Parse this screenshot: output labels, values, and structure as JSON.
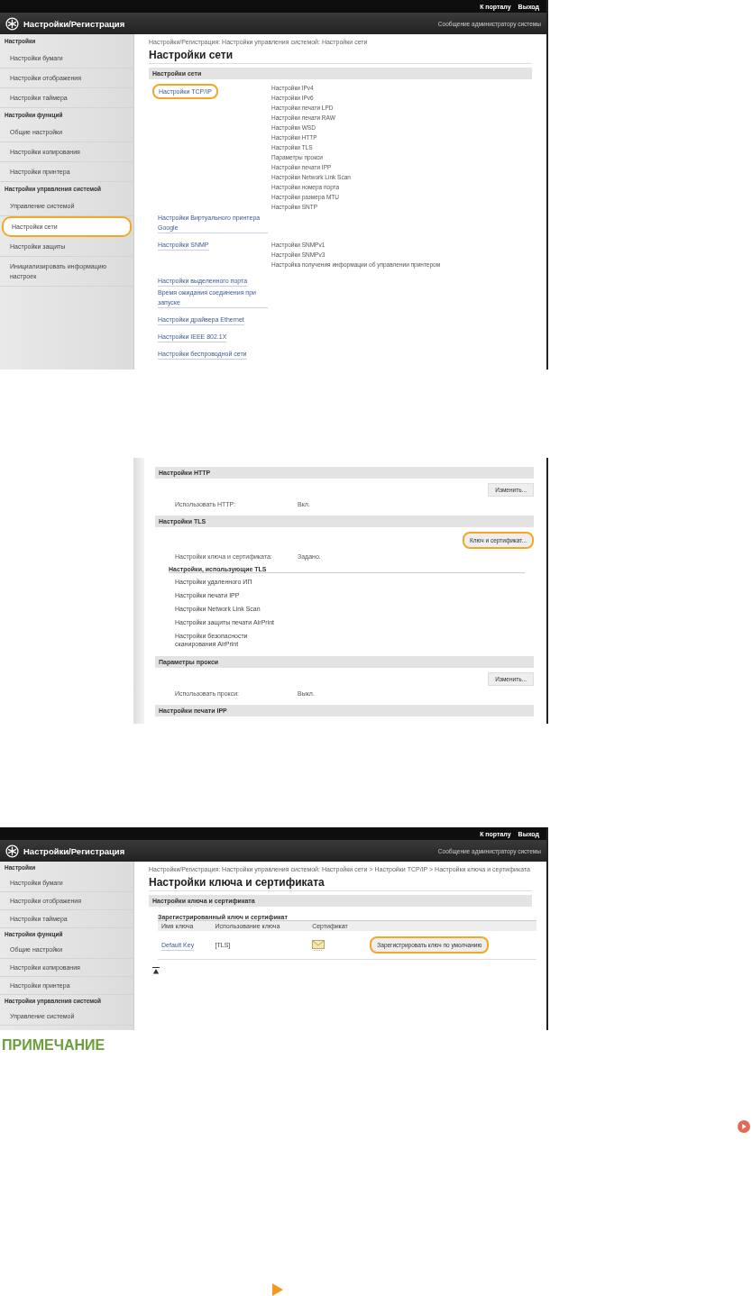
{
  "shot_1": {
    "top_links": [
      "К порталу",
      "Выход"
    ],
    "app_title": "Настройки/Регистрация",
    "admin_link": "Сообщение администратору системы",
    "sidebar": [
      {
        "title": "Настройки",
        "items": [
          {
            "label": "Настройки бумаги",
            "highlighted": false
          },
          {
            "label": "Настройки отображения",
            "highlighted": false
          },
          {
            "label": "Настройки таймера",
            "highlighted": false
          }
        ]
      },
      {
        "title": "Настройки функций",
        "items": [
          {
            "label": "Общие настройки",
            "highlighted": false
          },
          {
            "label": "Настройки копирования",
            "highlighted": false
          },
          {
            "label": "Настройки принтера",
            "highlighted": false
          }
        ]
      },
      {
        "title": "Настройки управления системой",
        "items": [
          {
            "label": "Управление системой",
            "highlighted": false
          },
          {
            "label": "Настройки сети",
            "highlighted": true
          },
          {
            "label": "Настройки защиты",
            "highlighted": false
          },
          {
            "label": "Инициализировать информацию настроек",
            "highlighted": false
          }
        ]
      }
    ],
    "breadcrumb": "Настройки/Регистрация: Настройки управления системой: Настройки сети",
    "page_title": "Настройки сети",
    "section_title": "Настройки сети",
    "links": [
      {
        "label": "Настройки TCP/IP",
        "highlighted": true,
        "sub_items": [
          "Настройки IPv4",
          "Настройки IPv6",
          "Настройки печати LPD",
          "Настройки печати RAW",
          "Настройки WSD",
          "Настройки HTTP",
          "Настройки TLS",
          "Параметры прокси",
          "Настройки печати IPP",
          "Настройки Network Link Scan",
          "Настройки номера порта",
          "Настройки размера MTU",
          "Настройки SNTP"
        ]
      },
      {
        "label": "Настройки Виртуального принтера Google",
        "highlighted": false
      },
      {
        "label": "Настройки SNMP",
        "highlighted": false,
        "sub_items": [
          "Настройки SNMPv1",
          "Настройки SNMPv3",
          "Настройка получения информации об управлении принтером"
        ]
      },
      {
        "label": "Настройки выделенного порта",
        "highlighted": false
      },
      {
        "label": "Время ожидания соединения при запуске",
        "highlighted": false
      },
      {
        "label": "Настройки драйвера Ethernet",
        "highlighted": false
      },
      {
        "label": "Настройки IEEE 802.1X",
        "highlighted": false
      },
      {
        "label": "Настройки беспроводной сети",
        "highlighted": false
      }
    ]
  },
  "shot_2": {
    "sections": [
      {
        "title": "Настройки HTTP",
        "button": {
          "label": "Изменить...",
          "highlighted": false
        },
        "rows": [
          {
            "label": "Использовать HTTP:",
            "value": "Вкл."
          }
        ]
      },
      {
        "title": "Настройки TLS",
        "button": {
          "label": "Ключ и сертификат...",
          "highlighted": true
        },
        "rows": [
          {
            "label": "Настройки ключа и сертификата:",
            "value": "Задано."
          }
        ],
        "subheading": "Настройки, использующие TLS",
        "list": [
          "Настройки удаленного ИП",
          "Настройки печати IPP",
          "Настройки Network Link Scan",
          "Настройки защиты печати AirPrint",
          "Настройки безопасности сканирования AirPrint"
        ]
      },
      {
        "title": "Параметры прокси",
        "button": {
          "label": "Изменить...",
          "highlighted": false
        },
        "rows": [
          {
            "label": "Использовать прокси:",
            "value": "Выкл."
          }
        ]
      },
      {
        "title": "Настройки печати IPP"
      }
    ]
  },
  "shot_3": {
    "top_links": [
      "К порталу",
      "Выход"
    ],
    "app_title": "Настройки/Регистрация",
    "admin_link": "Сообщение администратору системы",
    "sidebar": [
      {
        "title": "Настройки",
        "items": [
          {
            "label": "Настройки бумаги",
            "highlighted": false
          },
          {
            "label": "Настройки отображения",
            "highlighted": false
          },
          {
            "label": "Настройки таймера",
            "highlighted": false
          }
        ]
      },
      {
        "title": "Настройки функций",
        "items": [
          {
            "label": "Общие настройки",
            "highlighted": false
          },
          {
            "label": "Настройки копирования",
            "highlighted": false
          },
          {
            "label": "Настройки принтера",
            "highlighted": false
          }
        ]
      },
      {
        "title": "Настройки управления системой",
        "items": [
          {
            "label": "Управление системой",
            "highlighted": false
          }
        ]
      }
    ],
    "breadcrumb": "Настройки/Регистрация: Настройки управления системой: Настройки сети > Настройки TCP/IP > Настройки ключа и сертификата",
    "page_title": "Настройки ключа и сертификата",
    "section_title": "Настройки ключа и сертификата",
    "table_title": "Зарегистрированный ключ и сертификат",
    "table": {
      "columns": [
        "Имя ключа",
        "Использование ключа",
        "Сертификат"
      ],
      "rows": [
        {
          "key_name": "Default Key",
          "usage": "[TLS]",
          "button": {
            "label": "Зарегистрировать ключ по умолчанию",
            "highlighted": true
          }
        }
      ]
    }
  },
  "note_title": "ПРИМЕЧАНИЕ"
}
